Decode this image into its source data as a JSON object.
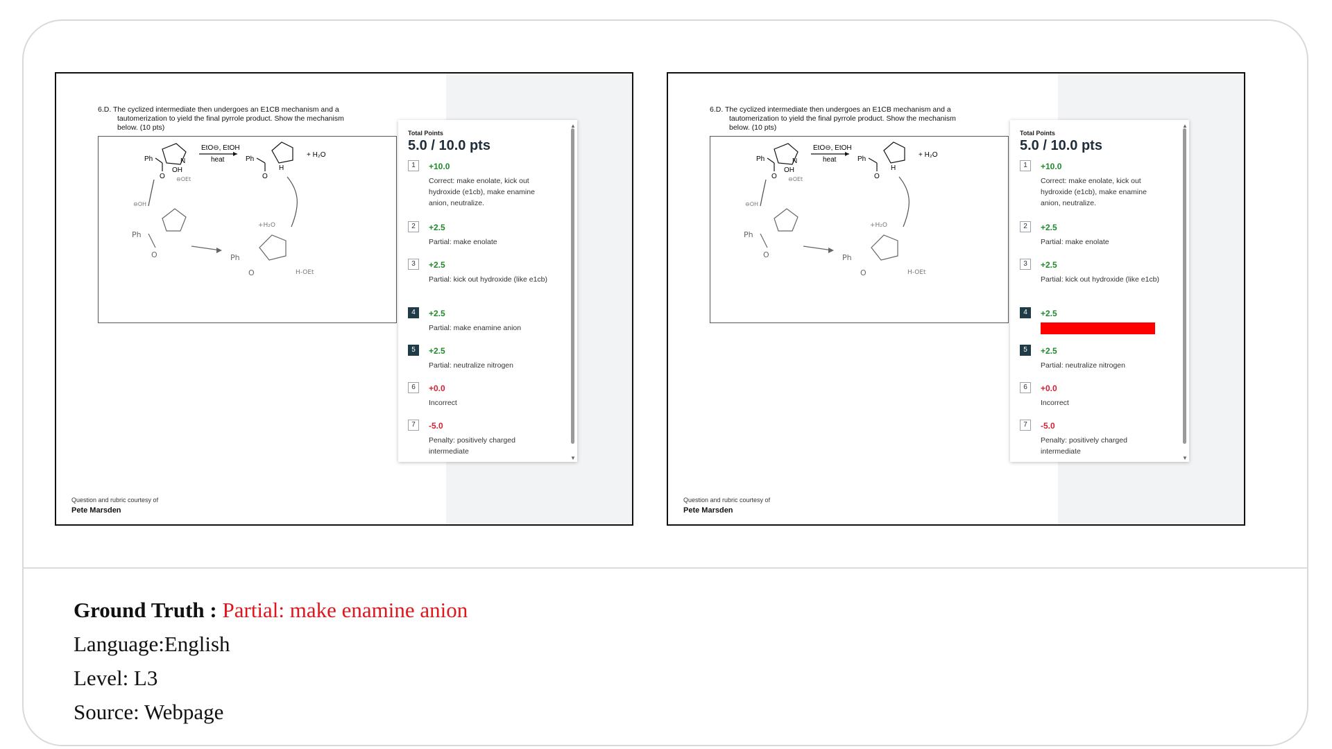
{
  "question": {
    "line1": "6.D. The cyclized intermediate then undergoes an E1CB mechanism and a",
    "line2": "tautomerization to yield the final pyrrole product. Show the mechanism",
    "line3": "below. (10 pts)"
  },
  "scheme": {
    "reagent_top": "EtO⊖, EtOH",
    "reagent_bottom": "heat",
    "byproduct": "+ H₂O",
    "ph": "Ph",
    "oh": "OH",
    "h": "H",
    "n": "N",
    "o": "O"
  },
  "handwriting": {
    "oet": "⊖OEt",
    "ooh": "⊖OH",
    "plus_h2o": "+H₂O",
    "h_oet": "H-OEt",
    "ph": "Ph"
  },
  "credit": {
    "line1": "Question and rubric courtesy of",
    "name": "Pete Marsden"
  },
  "rubric": {
    "header": "Total Points",
    "total": "5.0 / 10.0 pts",
    "items": [
      {
        "num": "1",
        "points": "+10.0",
        "desc": "Correct: make enolate, kick out hydroxide (e1cb), make enamine anion, neutralize.",
        "selected": false
      },
      {
        "num": "2",
        "points": "+2.5",
        "desc": "Partial: make enolate",
        "selected": false
      },
      {
        "num": "3",
        "points": "+2.5",
        "desc": "Partial: kick out hydroxide (like e1cb)",
        "selected": false
      },
      {
        "num": "4",
        "points": "+2.5",
        "desc": "Partial: make enamine anion",
        "selected": true
      },
      {
        "num": "5",
        "points": "+2.5",
        "desc": "Partial: neutralize nitrogen",
        "selected": true
      },
      {
        "num": "6",
        "points": "+0.0",
        "desc": "Incorrect",
        "selected": false
      },
      {
        "num": "7",
        "points": "-5.0",
        "desc": "Penalty: positively charged intermediate",
        "selected": false
      }
    ]
  },
  "meta": {
    "gt_label": "Ground Truth :",
    "gt_value": "Partial: make enamine anion",
    "language": "Language:English",
    "level": "Level: L3",
    "source": "Source: Webpage"
  },
  "colors": {
    "positive": "#1e8a2a",
    "negative": "#d31f34",
    "selected_box": "#1f3b48",
    "redaction": "#ff0000",
    "ground_truth": "#e0161d"
  }
}
